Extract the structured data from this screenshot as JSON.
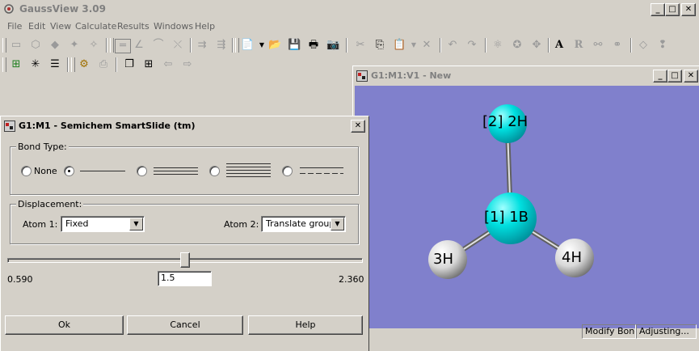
{
  "app": {
    "title": "GaussView 3.09"
  },
  "menu": [
    {
      "label": "File"
    },
    {
      "label": "Edit"
    },
    {
      "label": "View"
    },
    {
      "label": "Calculate"
    },
    {
      "label": "Results"
    },
    {
      "label": "Windows"
    },
    {
      "label": "Help"
    }
  ],
  "window_buttons": {
    "minimize": "_",
    "maximize": "□",
    "close": "✕"
  },
  "dialog": {
    "title": "G1:M1 - Semichem SmartSlide (tm)",
    "bond_type": {
      "label": "Bond Type:",
      "none_label": "None",
      "selected": "single"
    },
    "displacement": {
      "label": "Displacement:",
      "atom1_label": "Atom 1:",
      "atom1_value": "Fixed",
      "atom2_label": "Atom 2:",
      "atom2_value": "Translate group"
    },
    "slider": {
      "min_label": "0.590",
      "max_label": "2.360",
      "value": "1.5",
      "position_fraction": 0.5
    },
    "buttons": {
      "ok": "Ok",
      "cancel": "Cancel",
      "help": "Help"
    }
  },
  "viewer": {
    "title": "G1:M1:V1 - New",
    "atoms": [
      {
        "label": "[2] 2H",
        "color": "#00dddd"
      },
      {
        "label": "[1] 1B",
        "color": "#00dddd"
      },
      {
        "label": "3H",
        "color": "#e8e8e8"
      },
      {
        "label": "4H",
        "color": "#e8e8e8"
      }
    ],
    "background_color": "#8080cc"
  },
  "status": {
    "mode": "Modify Bond",
    "activity": "Adjusting..."
  }
}
